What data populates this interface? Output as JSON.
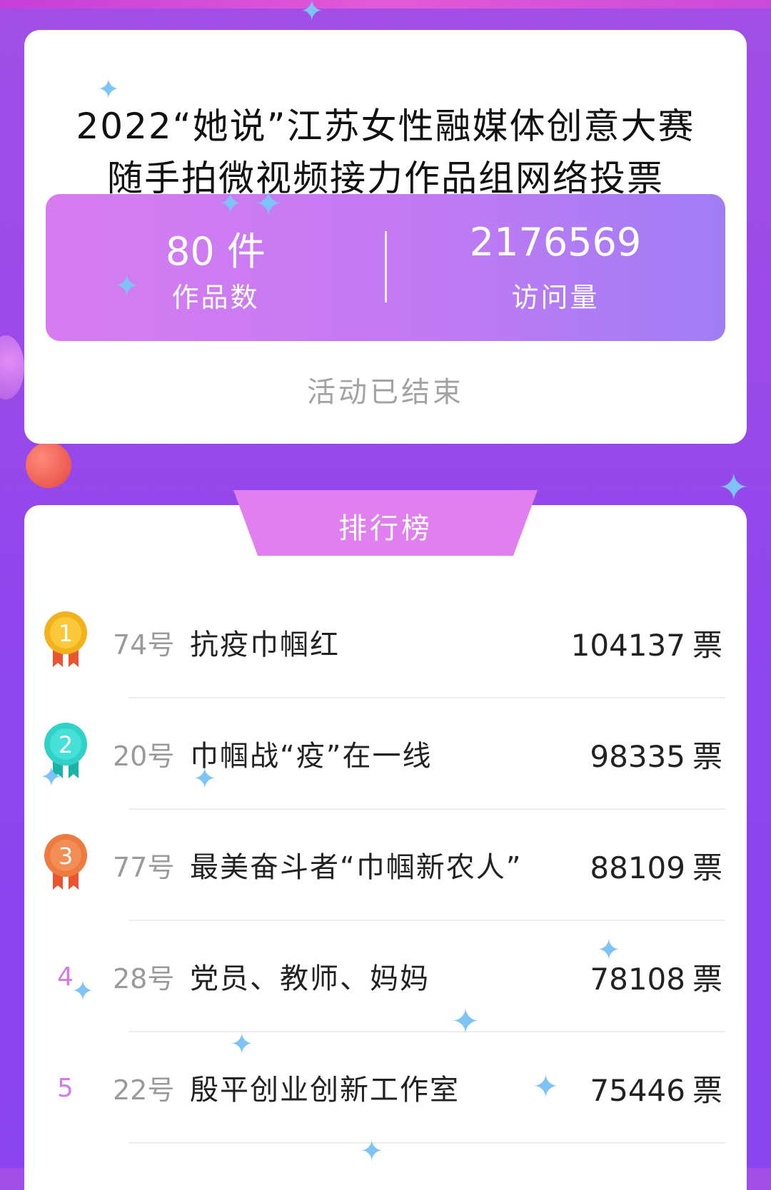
{
  "activity": {
    "title_line1": "2022“她说”江苏女性融媒体创意大赛",
    "title_line2": "随手拍微视频接力作品组网络投票",
    "works_count": "80 件",
    "works_label": "作品数",
    "visits_count": "2176569",
    "visits_label": "访问量",
    "status": "活动已结束"
  },
  "ranking": {
    "title": "排行榜",
    "vote_unit": "票",
    "items": [
      {
        "rank": "1",
        "no": "74号",
        "name": "抗疫巾帼红",
        "votes": "104137"
      },
      {
        "rank": "2",
        "no": "20号",
        "name": "巾帼战“疫”在一线",
        "votes": "98335"
      },
      {
        "rank": "3",
        "no": "77号",
        "name": "最美奋斗者“巾帼新农人”",
        "votes": "88109"
      },
      {
        "rank": "4",
        "no": "28号",
        "name": "党员、教师、妈妈",
        "votes": "78108"
      },
      {
        "rank": "5",
        "no": "22号",
        "name": "殷平创业创新工作室",
        "votes": "75446"
      }
    ]
  },
  "colors": {
    "medal_gold": "#f3b21c",
    "medal_silver": "#2fd1c9",
    "medal_bronze": "#ee7a3f",
    "accent_pink": "#e17ff0"
  }
}
